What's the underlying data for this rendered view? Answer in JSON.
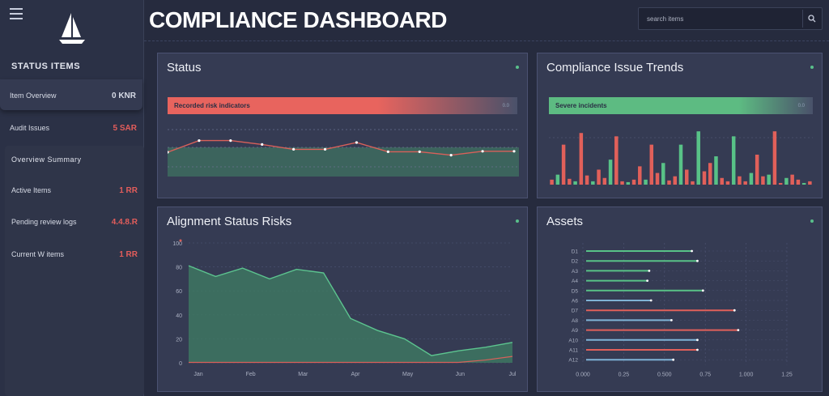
{
  "header": {
    "title": "COMPLIANCE DASHBOARD",
    "search_placeholder": "search items"
  },
  "sidebar": {
    "section_title": "STATUS ITEMS",
    "card1": [
      {
        "label": "Item Overview",
        "value": "0 KNR",
        "tone": "light"
      },
      {
        "label": "Audit Issues",
        "value": "5 SAR",
        "tone": "red"
      }
    ],
    "section2_title": "Overview Summary",
    "card2": [
      {
        "label": "Active Items",
        "value": "1 RR",
        "tone": "red"
      },
      {
        "label": "Pending review logs",
        "value": "4.4.8.R",
        "tone": "red"
      },
      {
        "label": "Current W items",
        "value": "1 RR",
        "tone": "red"
      }
    ]
  },
  "panels": {
    "status": {
      "title": "Status",
      "banner_label": "Recorded risk indicators",
      "banner_end": "0.0",
      "colors": {
        "banner": "#e8645e",
        "line": "#d9605a",
        "fill": "#3f7360"
      }
    },
    "compliance": {
      "title": "Compliance Issue Trends",
      "banner_label": "Severe incidents",
      "banner_end": "0.0",
      "colors": {
        "banner": "#5dbb82",
        "green": "#58c287",
        "red": "#e1605a"
      }
    },
    "risks": {
      "title": "Alignment Status Risks",
      "y_ticks": [
        "100",
        "80",
        "60",
        "40",
        "20",
        "0"
      ],
      "x_ticks": [
        "Jan",
        "Feb",
        "Mar",
        "Apr",
        "May",
        "Jun",
        "Jul"
      ],
      "colors": {
        "area": "#3e7a63",
        "line": "#5cc48f",
        "red_line": "#d9605a"
      }
    },
    "assets": {
      "title": "Assets",
      "rows": [
        "D1",
        "D2",
        "A3",
        "A4",
        "D5",
        "A6",
        "D7",
        "A8",
        "A9",
        "A10",
        "A11",
        "A12"
      ],
      "x_ticks": [
        "0.000",
        "0.25",
        "0.500",
        "0.75",
        "1.000",
        "1.25"
      ],
      "colors": {
        "red": "#e1605a",
        "green": "#58c287",
        "blue": "#7fb3d6"
      }
    }
  },
  "chart_data": [
    {
      "type": "line",
      "title": "Status",
      "x": [
        0,
        1,
        2,
        3,
        4,
        5,
        6,
        7,
        8,
        9,
        10,
        11
      ],
      "series": [
        {
          "values": [
            50,
            74,
            74,
            66,
            56,
            56,
            70,
            51,
            51,
            44,
            52,
            52
          ]
        }
      ],
      "ylim": [
        0,
        100
      ]
    },
    {
      "type": "bar",
      "title": "Compliance Issue Trends",
      "x": [
        1,
        2,
        3,
        4,
        5,
        6,
        7,
        8,
        9,
        10,
        11,
        12,
        13,
        14,
        15,
        16,
        17,
        18,
        19,
        20,
        21,
        22,
        23,
        24,
        25,
        26,
        27,
        28,
        29,
        30,
        31,
        32,
        33,
        34,
        35,
        36,
        37,
        38,
        39,
        40,
        41,
        42,
        43,
        44,
        45
      ],
      "series": [
        {
          "values": [
            6,
            12,
            48,
            7,
            4,
            62,
            11,
            4,
            18,
            8,
            30,
            58,
            4,
            3,
            6,
            22,
            6,
            48,
            14,
            26,
            5,
            10,
            48,
            18,
            4,
            64,
            16,
            26,
            34,
            8,
            4,
            58,
            10,
            4,
            14,
            36,
            10,
            12,
            64,
            2,
            8,
            12,
            6,
            2,
            4
          ]
        }
      ],
      "ylim": [
        0,
        70
      ]
    },
    {
      "type": "area",
      "title": "Alignment Status Risks",
      "x": [
        0,
        1,
        2,
        3,
        4,
        5,
        6,
        7,
        8,
        9,
        10,
        11,
        12
      ],
      "series": [
        {
          "values": [
            81,
            72,
            79,
            70,
            78,
            75,
            37,
            27,
            20,
            6,
            10,
            13,
            17
          ]
        },
        {
          "values": [
            0,
            0,
            0,
            0,
            0,
            0,
            0,
            0,
            0,
            0,
            0,
            2,
            5
          ]
        }
      ],
      "ylim": [
        0,
        100
      ]
    },
    {
      "type": "bar",
      "title": "Assets",
      "categories": [
        "D1",
        "D2",
        "A3",
        "A4",
        "D5",
        "A6",
        "D7",
        "A8",
        "A9",
        "A10",
        "A11",
        "A12"
      ],
      "values": [
        0.57,
        0.6,
        0.34,
        0.33,
        0.63,
        0.35,
        0.8,
        0.46,
        0.82,
        0.6,
        0.6,
        0.47
      ],
      "colors": [
        "green",
        "green",
        "green",
        "green",
        "green",
        "blue",
        "red",
        "blue",
        "red",
        "blue",
        "red",
        "blue"
      ]
    }
  ]
}
